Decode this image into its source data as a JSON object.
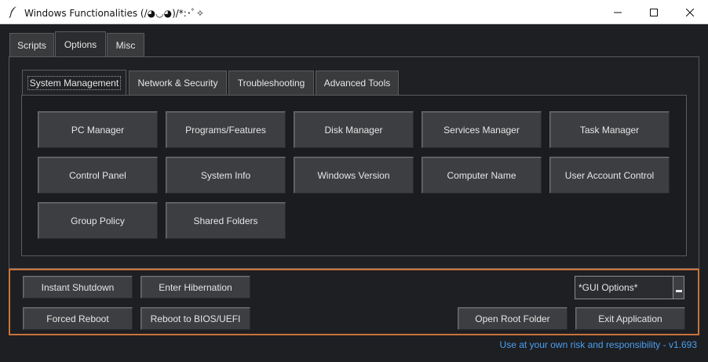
{
  "window": {
    "title": "Windows Functionalities (/◕◡◕)/*:･ﾟ✧"
  },
  "main_tabs": [
    {
      "label": "Scripts"
    },
    {
      "label": "Options"
    },
    {
      "label": "Misc"
    }
  ],
  "active_main_tab": "Options",
  "sub_tabs": [
    {
      "label": "System Management"
    },
    {
      "label": "Network & Security"
    },
    {
      "label": "Troubleshooting"
    },
    {
      "label": "Advanced Tools"
    }
  ],
  "active_sub_tab": "System Management",
  "system_management": {
    "buttons": [
      "PC Manager",
      "Programs/Features",
      "Disk Manager",
      "Services Manager",
      "Task Manager",
      "Control Panel",
      "System Info",
      "Windows Version",
      "Computer Name",
      "User Account Control",
      "Group Policy",
      "Shared Folders"
    ]
  },
  "bottom": {
    "instant_shutdown": "Instant Shutdown",
    "enter_hibernation": "Enter Hibernation",
    "forced_reboot": "Forced Reboot",
    "reboot_bios": "Reboot to BIOS/UEFI",
    "open_root_folder": "Open Root Folder",
    "exit_application": "Exit Application",
    "gui_options_value": "*GUI Options*"
  },
  "footer": "Use at your own risk and responsibility - v1.693",
  "colors": {
    "accent_border": "#c8733a",
    "footer_text": "#4a9ff0",
    "background": "#1e1f22"
  }
}
